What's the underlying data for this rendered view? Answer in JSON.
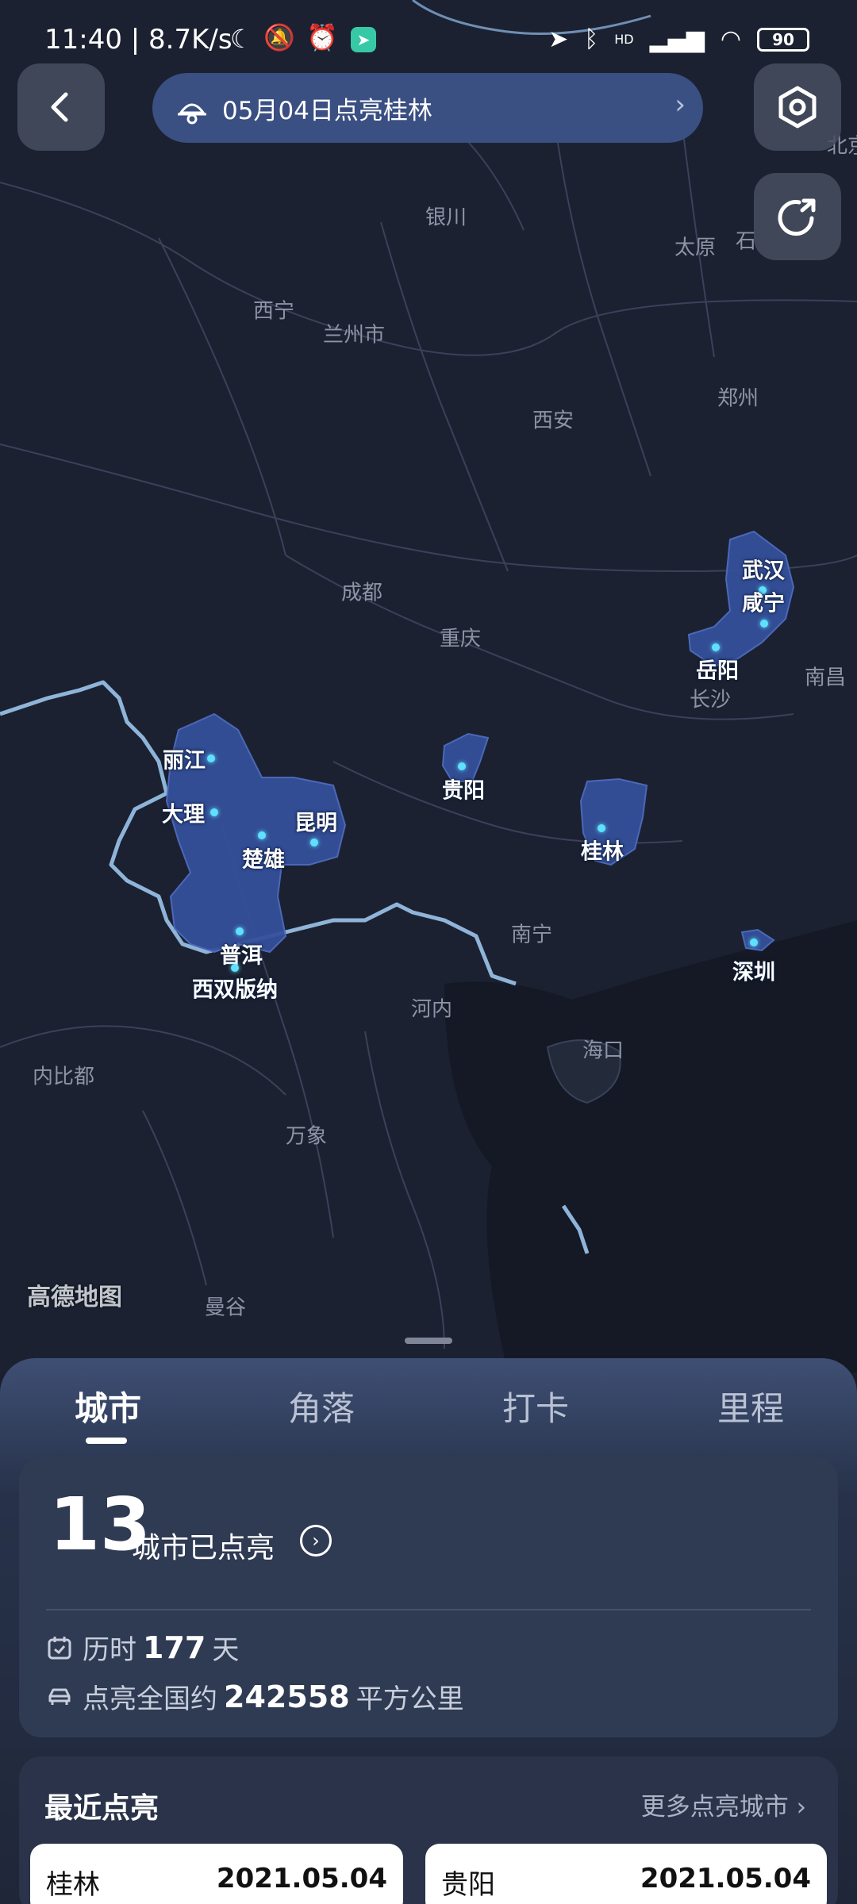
{
  "status_bar": {
    "time_speed": "11:40 | 8.7K/s",
    "battery": "90",
    "network_badge": "HD"
  },
  "header": {
    "title": "05月04日点亮桂林"
  },
  "map": {
    "attribution": "高德地图",
    "cities": [
      "银川",
      "西宁",
      "兰州市",
      "太原",
      "郑州",
      "西安",
      "成都",
      "重庆",
      "长沙",
      "南昌",
      "南宁",
      "河内",
      "海口",
      "内比都",
      "万象",
      "曼谷",
      "北京",
      "石"
    ],
    "lit_cities": [
      "丽江",
      "大理",
      "昆明",
      "楚雄",
      "普洱",
      "西双版纳",
      "贵阳",
      "桂林",
      "武汉",
      "咸宁",
      "岳阳",
      "深圳"
    ],
    "highlight_color": "#3a5aa8"
  },
  "tabs": [
    "城市",
    "角落",
    "打卡",
    "里程"
  ],
  "summary": {
    "city_count": "13",
    "city_label": "城市已点亮",
    "duration_prefix": "历时",
    "duration_value": "177",
    "duration_unit": "天",
    "area_prefix": "点亮全国约",
    "area_value": "242558",
    "area_unit": "平方公里"
  },
  "recent": {
    "title": "最近点亮",
    "more": "更多点亮城市",
    "items": [
      {
        "name": "桂林",
        "date": "2021.05.04"
      },
      {
        "name": "贵阳",
        "date": "2021.05.04"
      }
    ]
  }
}
